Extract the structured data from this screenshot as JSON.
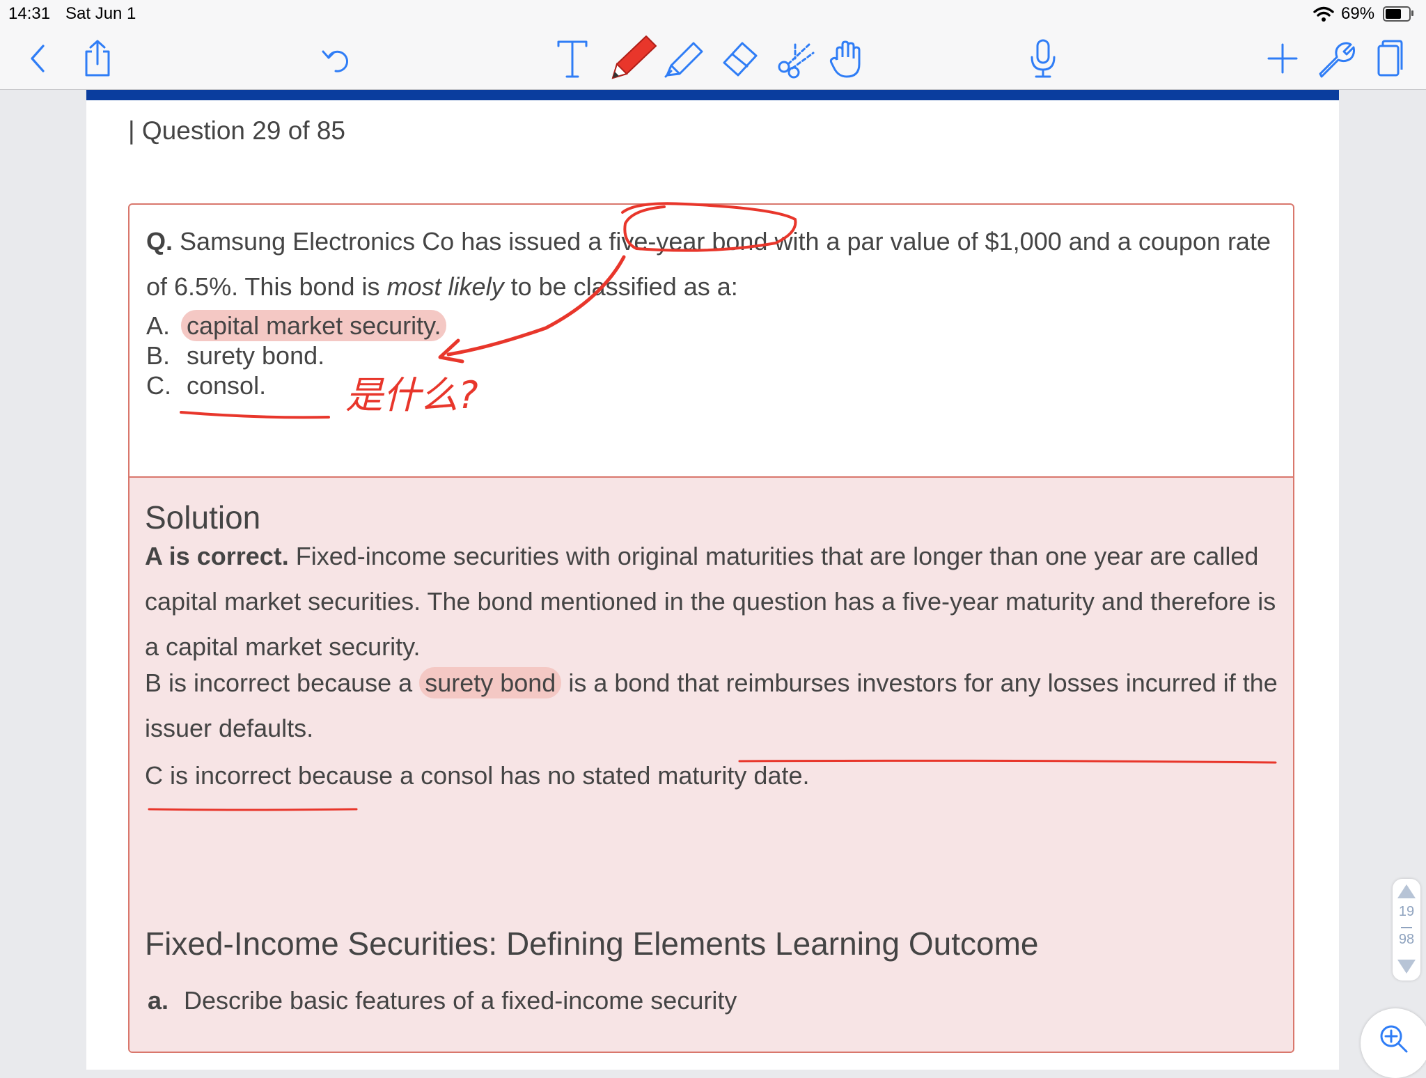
{
  "status_bar": {
    "time": "14:31",
    "date": "Sat Jun 1",
    "battery_percent": "69%",
    "battery_level": 0.69
  },
  "toolbar": {
    "icons": [
      "back-icon",
      "share-icon",
      "undo-icon",
      "text-tool-icon",
      "pen-icon",
      "highlighter-icon",
      "eraser-icon",
      "scissors-icon",
      "hand-icon",
      "microphone-icon",
      "add-icon",
      "wrench-icon",
      "page-icon"
    ],
    "active_tool": "pen-icon",
    "pen_color": "#e8362b"
  },
  "document": {
    "question_count": "| Question 29 of 85",
    "question": {
      "prefix": "Q.",
      "text_1": "Samsung Electronics Co has issued a five-year bond with a par value of $1,000 and a coupon rate of 6.5%. This bond is ",
      "emphasis": "most likely",
      "text_2": " to be classified as a:"
    },
    "choices": [
      {
        "letter": "A.",
        "text": "capital market security."
      },
      {
        "letter": "B.",
        "text": "surety bond."
      },
      {
        "letter": "C.",
        "text": "consol."
      }
    ],
    "solution": {
      "title": "Solution",
      "correct_prefix": "A is correct.",
      "correct_text": " Fixed-income securities with original maturities that are longer than one year are called capital market securities. The bond mentioned in the question has a five-year maturity and therefore is a capital market security.",
      "b_text_1": "B is incorrect because a ",
      "b_highlight": "surety bond",
      "b_text_2": " is a bond that reimburses investors for any losses incurred if the issuer defaults.",
      "c_text": "C is incorrect because a consol has no stated maturity date."
    },
    "learning_outcome": {
      "title": "Fixed-Income Securities: Defining Elements Learning Outcome",
      "item_letter": "a.",
      "item_text": "Describe basic features of a fixed-income security"
    },
    "annotations": {
      "handwritten_note": "是什么?",
      "ink_color": "#e8362b",
      "highlight_color": "#f4c8c4"
    }
  },
  "pager": {
    "current_page": "19",
    "total_pages": "98"
  }
}
